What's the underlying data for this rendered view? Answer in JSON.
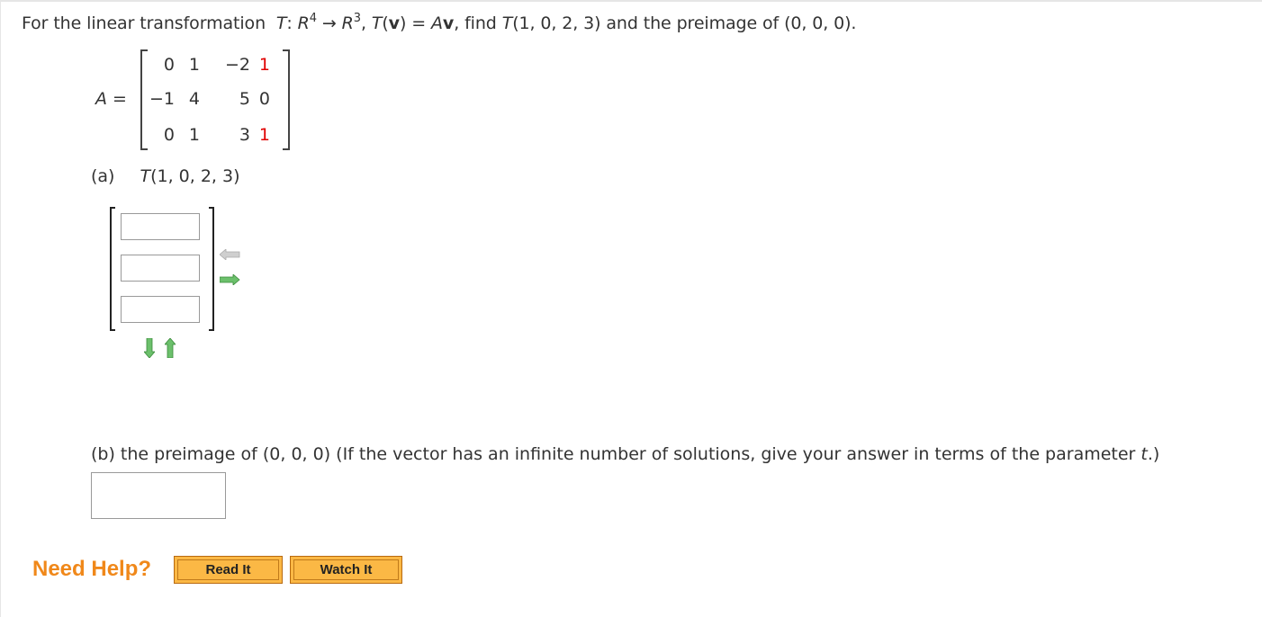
{
  "question": {
    "intro": "For the linear transformation",
    "T": "T",
    "colon": ": ",
    "R": "R",
    "dom_exp": "4",
    "arrow": " → ",
    "codom_exp": "3",
    "comma": ", ",
    "Tv_T": "T",
    "Tv_open": "(",
    "v": "v",
    "Tv_close": ") = ",
    "A": "A",
    "find_text": ",  find ",
    "find_T": "T",
    "find_args": "(1, 0, 2, 3) and the preimage of (0, 0, 0)."
  },
  "matrix": {
    "label_var": "A",
    "label_eq": " =",
    "rows": [
      [
        "0",
        "1",
        "−2",
        "1"
      ],
      [
        "−1",
        "4",
        "5",
        "0"
      ],
      [
        "0",
        "1",
        "3",
        "1"
      ]
    ],
    "highlight_color": "#e00000"
  },
  "part_a": {
    "label": "(a)",
    "T": "T",
    "args": "(1, 0, 2, 3)",
    "inputs": [
      "",
      "",
      ""
    ]
  },
  "part_b": {
    "prefix": "(b) the preimage of (0, 0, 0) (If the vector has an infinite number of solutions, give your answer in terms of the parameter ",
    "param": "t",
    "suffix": ".)",
    "input": ""
  },
  "help": {
    "label": "Need Help?",
    "read_it": "Read It",
    "watch_it": "Watch It",
    "accent": "#f0881a"
  }
}
